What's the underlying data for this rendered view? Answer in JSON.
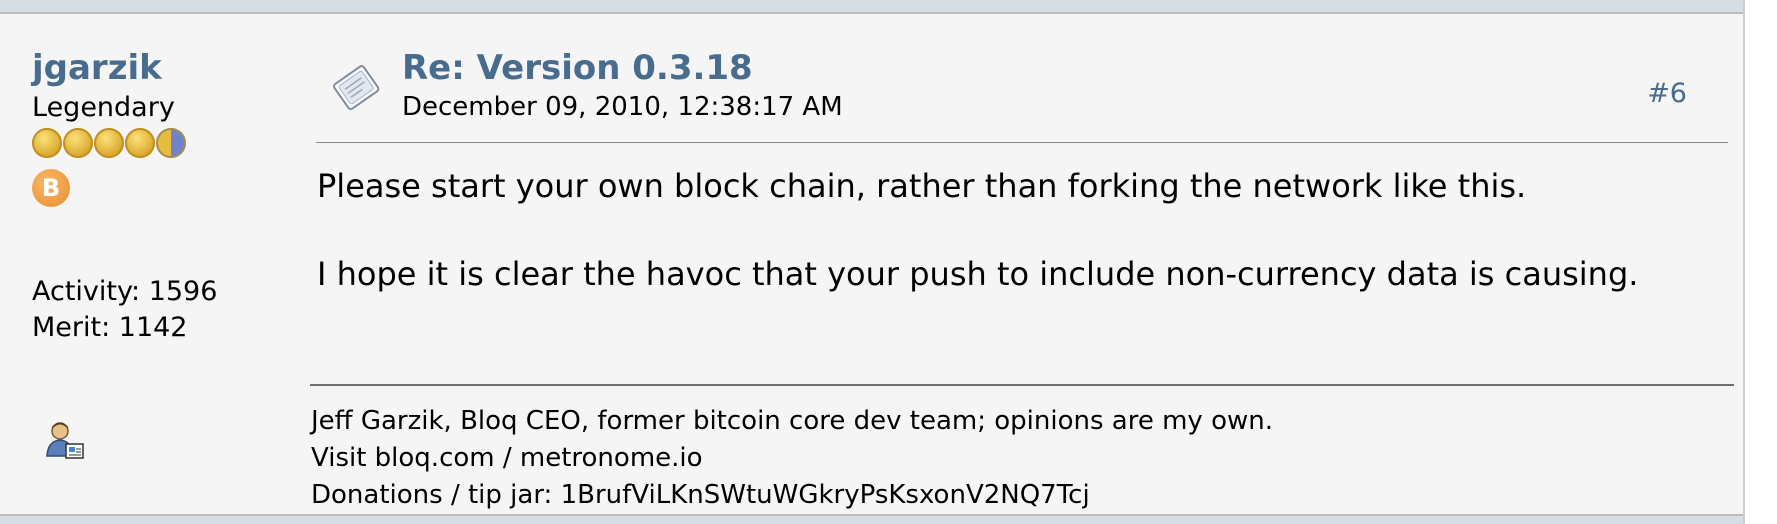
{
  "poster": {
    "name": "jgarzik",
    "rank": "Legendary",
    "coin_count": 4.5,
    "activity": "Activity: 1596",
    "merit": "Merit: 1142",
    "badge_glyph": "B",
    "badge_icon": "bitcoin-badge-icon",
    "profile_icon": "user-profile-icon"
  },
  "post": {
    "icon": "message-document-icon",
    "subject": "Re: Version 0.3.18",
    "timestamp": "December 09, 2010, 12:38:17 AM",
    "number": "#6",
    "body": [
      "Please start your own block chain, rather than forking the network like this.",
      "I hope it is clear the havoc that your push to include non-currency data is causing."
    ],
    "signature": [
      "Jeff Garzik, Bloq CEO, former bitcoin core dev team; opinions are my own.",
      "Visit bloq.com / metronome.io",
      "Donations / tip jar: 1BrufViLKnSWtuWGkryPsKsxonV2NQ7Tcj"
    ]
  },
  "colors": {
    "link": "#476c8e",
    "post_background": "#f5f5f5",
    "strip": "#d8dde1",
    "coin_gold": "#e7bd3f",
    "coin_blue": "#6f82cc",
    "bitcoin_orange": "#ee9a3d"
  }
}
